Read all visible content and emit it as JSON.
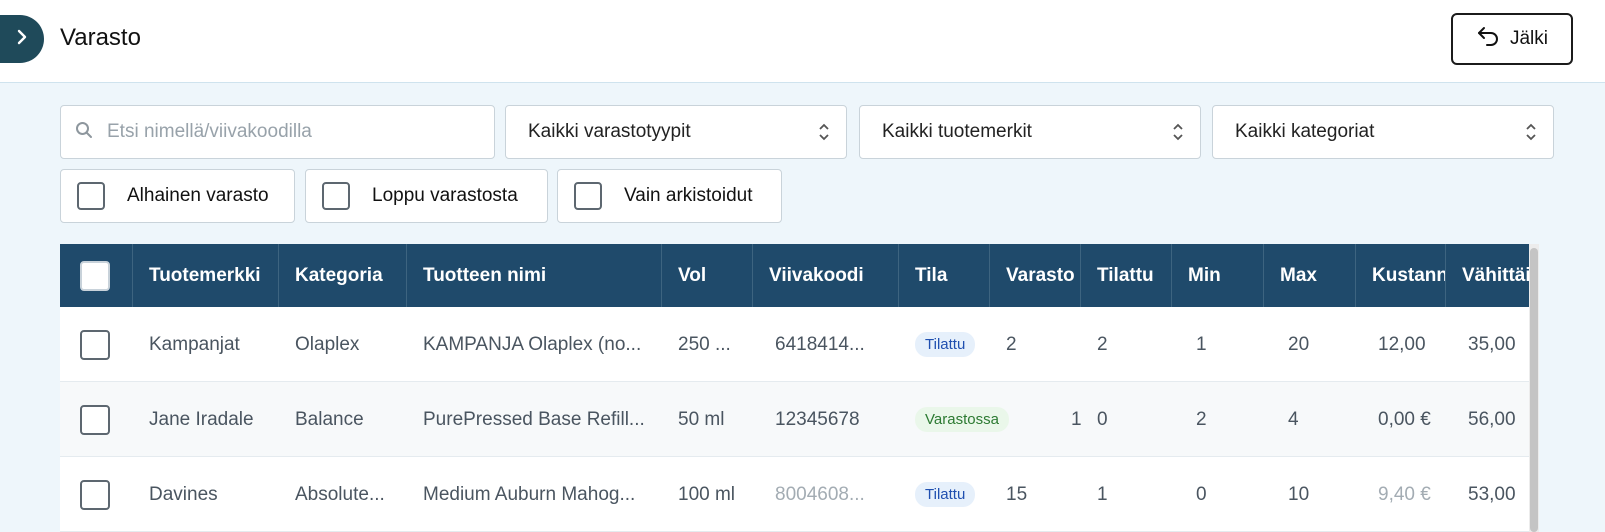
{
  "header": {
    "title": "Varasto",
    "back_label": "Jälki"
  },
  "filters": {
    "search_placeholder": "Etsi nimellä/viivakoodilla",
    "stock_type": "Kaikki varastotyypit",
    "brand": "Kaikki tuotemerkit",
    "category": "Kaikki kategoriat",
    "low_stock": "Alhainen varasto",
    "out_of_stock": "Loppu varastosta",
    "archived_only": "Vain arkistoidut"
  },
  "table": {
    "columns": [
      "Tuotemerkki",
      "Kategoria",
      "Tuotteen nimi",
      "Vol",
      "Viivakoodi",
      "Tila",
      "Varasto",
      "Tilattu",
      "Min",
      "Max",
      "Kustann",
      "Vähittäis"
    ],
    "rows": [
      {
        "brand": "Kampanjat",
        "category": "Olaplex",
        "name": "KAMPANJA Olaplex (no...",
        "vol": "250 ...",
        "barcode": "6418414...",
        "status": "Tilattu",
        "stock": "2",
        "ordered": "2",
        "min": "1",
        "max": "20",
        "cost": "12,00",
        "retail": "35,00"
      },
      {
        "brand": "Jane Iradale",
        "category": "Balance",
        "name": "PurePressed Base Refill...",
        "vol": "50 ml",
        "barcode": "12345678",
        "status": "Varastossa",
        "stock": "1",
        "ordered": "0",
        "min": "2",
        "max": "4",
        "cost": "0,00 €",
        "retail": "56,00"
      },
      {
        "brand": "Davines",
        "category": "Absolute...",
        "name": "Medium Auburn Mahog...",
        "vol": "100 ml",
        "barcode": "8004608...",
        "status": "Tilattu",
        "stock": "15",
        "ordered": "1",
        "min": "0",
        "max": "10",
        "cost": "9,40 €",
        "retail": "53,00"
      }
    ]
  },
  "colors": {
    "header_bg": "#1f4a6b",
    "page_bg": "#eef6fb",
    "status_ordered": "#1f4fb0",
    "status_in_stock": "#2c7a32"
  },
  "icons": {
    "expand": "chevron-right-icon",
    "back": "undo-arrow-icon",
    "search": "search-icon",
    "select": "up-down-chevron-icon"
  }
}
